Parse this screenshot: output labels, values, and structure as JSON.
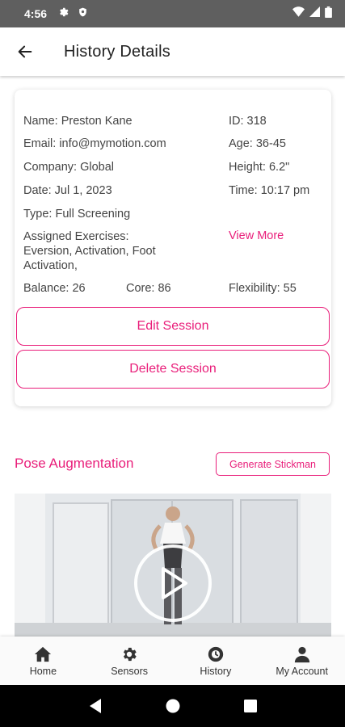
{
  "status_bar": {
    "time": "4:56"
  },
  "header": {
    "title": "History Details"
  },
  "details": {
    "name": "Name: Preston Kane",
    "id": "ID: 318",
    "email": "Email: info@mymotion.com",
    "age": "Age: 36-45",
    "company": "Company: Global",
    "height": "Height: 6.2\"",
    "date": "Date: Jul 1, 2023",
    "time": "Time: 10:17 pm",
    "type": "Type: Full Screening",
    "assigned_line1": "Assigned Exercises:",
    "assigned_line2": "Eversion, Activation, Foot",
    "assigned_line3": "Activation,",
    "view_more": "View More",
    "balance": "Balance: 26",
    "core": "Core: 86",
    "flexibility": "Flexibility: 55"
  },
  "actions": {
    "edit": "Edit Session",
    "delete": "Delete Session"
  },
  "pose": {
    "title": "Pose Augmentation",
    "generate": "Generate Stickman"
  },
  "nav": {
    "items": [
      {
        "label": "Home",
        "icon": "home-icon"
      },
      {
        "label": "Sensors",
        "icon": "gear-icon"
      },
      {
        "label": "History",
        "icon": "history-icon"
      },
      {
        "label": "My Account",
        "icon": "account-icon"
      }
    ]
  },
  "colors": {
    "accent": "#e91e7a",
    "status_bar": "#5f5f5f"
  }
}
